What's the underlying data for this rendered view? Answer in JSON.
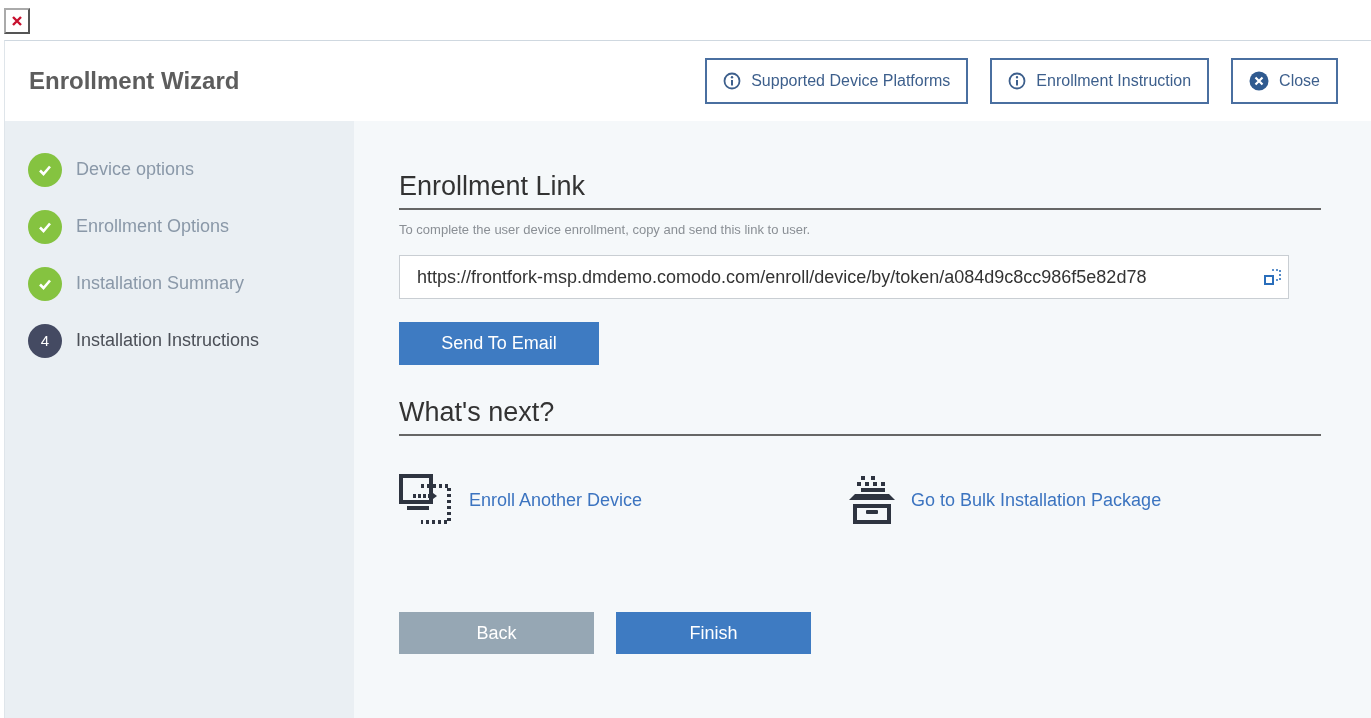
{
  "window": {
    "title": "Enrollment Wizard"
  },
  "header_buttons": [
    {
      "kind": "info",
      "label": "Supported Device Platforms"
    },
    {
      "kind": "info",
      "label": "Enrollment Instruction"
    },
    {
      "kind": "close",
      "label": "Close"
    }
  ],
  "steps": [
    {
      "label": "Device options",
      "completed": true,
      "selected": false
    },
    {
      "label": "Enrollment Options",
      "completed": true,
      "selected": false
    },
    {
      "label": "Installation Summary",
      "completed": true,
      "selected": false
    },
    {
      "label": "Installation Instructions",
      "completed": false,
      "selected": true,
      "number": "4"
    }
  ],
  "enrollment_link": {
    "heading": "Enrollment Link",
    "description": "To complete the user device enrollment, copy and send this link to user.",
    "value": "https://frontfork-msp.dmdemo.comodo.com/enroll/device/by/token/a084d9c8cc986f5e82d78",
    "send_button": "Send To Email"
  },
  "whats_next": {
    "heading": "What's next?",
    "links": [
      {
        "kind": "device",
        "label": "Enroll Another Device"
      },
      {
        "kind": "package",
        "label": "Go to Bulk Installation Package"
      }
    ]
  },
  "footer_buttons": [
    {
      "label": "Back",
      "disabled": true
    },
    {
      "label": "Finish",
      "disabled": false
    }
  ]
}
